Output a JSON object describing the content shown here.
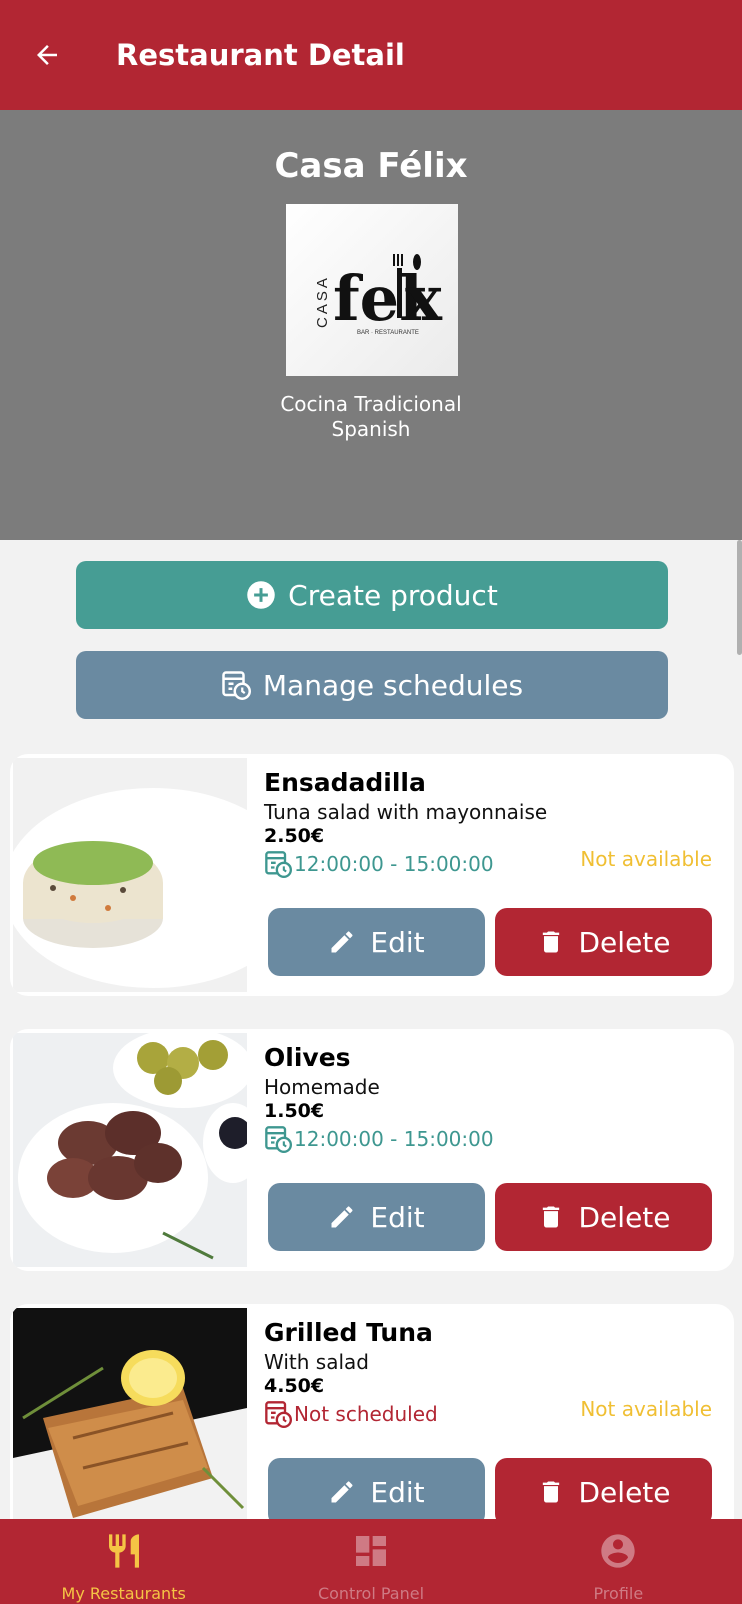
{
  "header": {
    "title": "Restaurant Detail"
  },
  "restaurant": {
    "name": "Casa Félix",
    "description": "Cocina Tradicional",
    "category": "Spanish",
    "logo_text": "CASA félix BAR · RESTAURANTE"
  },
  "actions": {
    "create_label": "Create product",
    "schedules_label": "Manage schedules"
  },
  "products": [
    {
      "name": "Ensadadilla",
      "description": "Tuna salad with mayonnaise",
      "price": "2.50€",
      "schedule": "12:00:00 - 15:00:00",
      "availability": "Not available",
      "edit_label": "Edit",
      "delete_label": "Delete"
    },
    {
      "name": "Olives",
      "description": "Homemade",
      "price": "1.50€",
      "schedule": "12:00:00 - 15:00:00",
      "availability": "",
      "edit_label": "Edit",
      "delete_label": "Delete"
    },
    {
      "name": "Grilled Tuna",
      "description": "With salad",
      "price": "4.50€",
      "schedule": "Not scheduled",
      "availability": "Not available",
      "edit_label": "Edit",
      "delete_label": "Delete"
    }
  ],
  "bottom_nav": [
    {
      "label": "My Restaurants",
      "icon": "restaurant-icon",
      "active": true
    },
    {
      "label": "Control Panel",
      "icon": "dashboard-icon",
      "active": false
    },
    {
      "label": "Profile",
      "icon": "account-circle-icon",
      "active": false
    }
  ],
  "colors": {
    "primary": "#b22633",
    "teal": "#469d94",
    "slate": "#6a8aa1",
    "warning": "#f0bf33",
    "active_nav": "#f5c445"
  }
}
